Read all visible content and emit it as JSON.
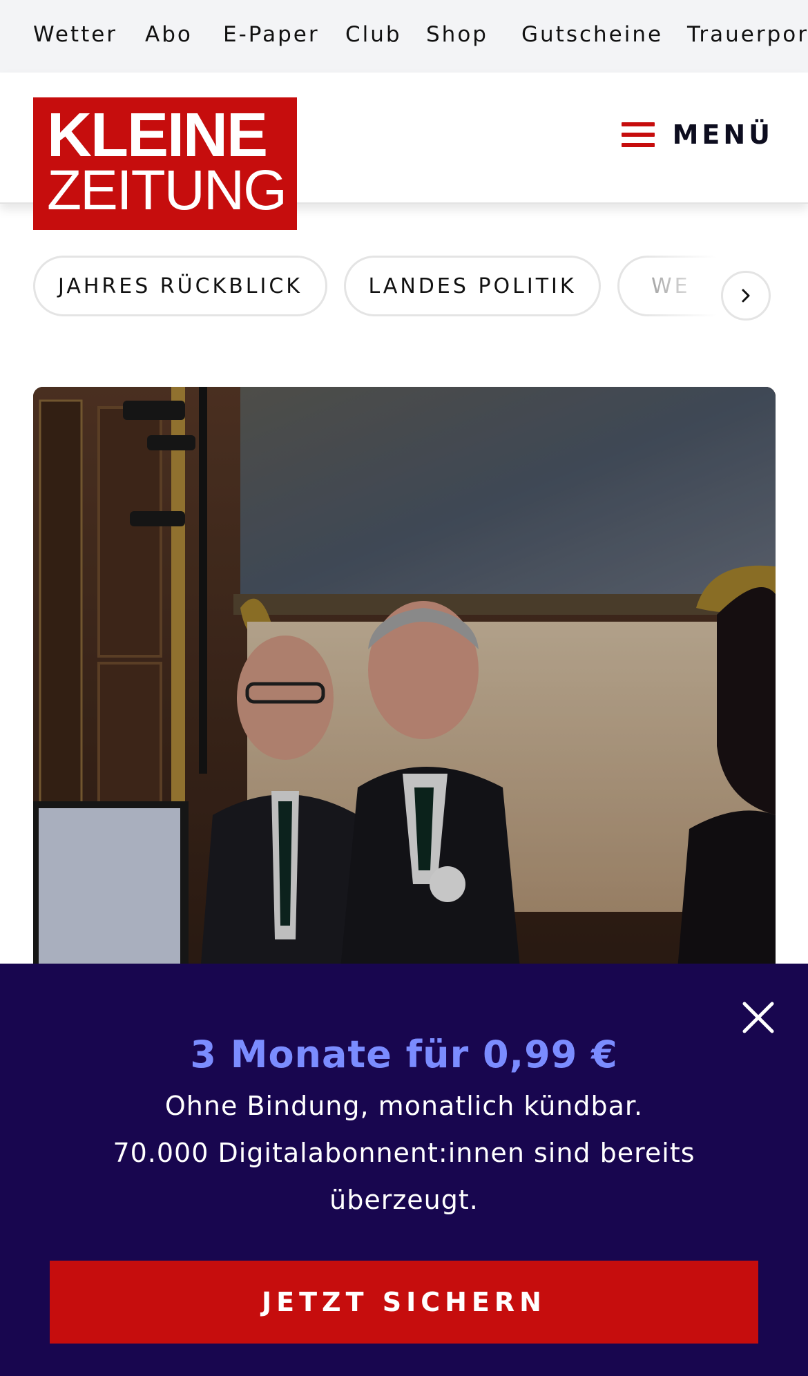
{
  "topnav": {
    "items": [
      "Wetter",
      "Abo",
      "E-Paper",
      "Club",
      "Shop",
      "Gutscheine",
      "Trauerportal"
    ]
  },
  "header": {
    "logo_line1": "KLEINE",
    "logo_line2": "ZEITUNG",
    "menu_label": "MENÜ",
    "menu_icon": "hamburger-icon"
  },
  "categories": {
    "pills": [
      "JAHRES RÜCKBLICK",
      "LANDES POLITIK",
      "WE"
    ],
    "scroll_icon": "chevron-right-icon"
  },
  "hero": {
    "image_icon": "article-photo"
  },
  "promo": {
    "headline": "3 Monate für 0,99 €",
    "line1": "Ohne Bindung, monatlich kündbar.",
    "line2": "70.000 Digitalabonnent:innen sind bereits",
    "line3": "überzeugt.",
    "cta_label": "JETZT SICHERN",
    "close_icon": "close-icon"
  },
  "colors": {
    "brand_red": "#c60d0d",
    "promo_bg": "#18064f",
    "promo_accent": "#7b8cff",
    "topnav_bg": "#f3f4f6"
  }
}
